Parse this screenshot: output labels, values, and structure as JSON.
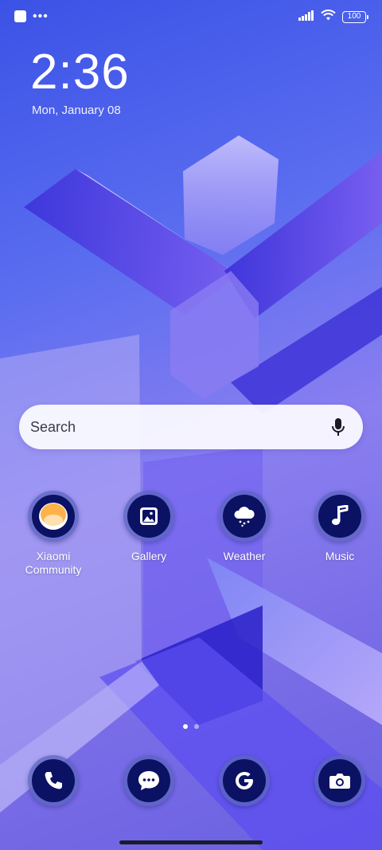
{
  "status_bar": {
    "battery_level": "100",
    "icons": [
      "notification-square-icon",
      "more-dots-icon",
      "signal-icon",
      "wifi-icon",
      "battery-icon"
    ]
  },
  "clock": {
    "time": "2:36",
    "date": "Mon, January 08"
  },
  "search": {
    "placeholder": "Search",
    "icon": "mic-icon"
  },
  "apps": [
    {
      "label": "Xiaomi\nCommunity",
      "icon": "xiaomi-community-icon"
    },
    {
      "label": "Gallery",
      "icon": "gallery-icon"
    },
    {
      "label": "Weather",
      "icon": "weather-icon"
    },
    {
      "label": "Music",
      "icon": "music-icon"
    }
  ],
  "page_indicator": {
    "pages": 2,
    "active": 1
  },
  "dock": [
    {
      "icon": "phone-icon"
    },
    {
      "icon": "messages-icon"
    },
    {
      "icon": "google-icon"
    },
    {
      "icon": "camera-icon"
    }
  ],
  "colors": {
    "icon_bg": "#0b1263",
    "accent": "#5a6df0"
  }
}
